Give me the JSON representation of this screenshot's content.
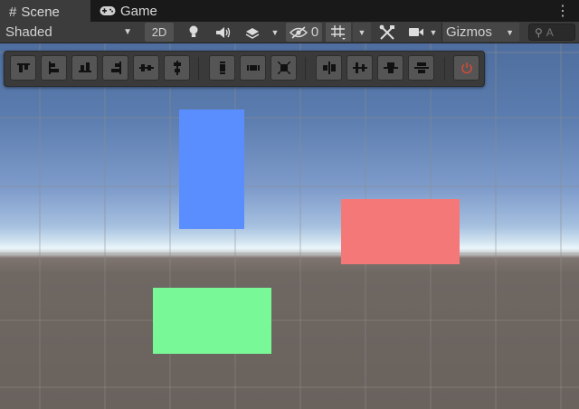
{
  "tabs": [
    {
      "label": "Scene",
      "icon": "grid-hash-icon",
      "active": true
    },
    {
      "label": "Game",
      "icon": "gamepad-icon",
      "active": false
    }
  ],
  "toolbar": {
    "draw_mode": "Shaded",
    "mode_2d": "2D",
    "hidden_count": "0",
    "gizmos": "Gizmos",
    "search_placeholder": "A"
  },
  "align_tools": [
    "align-top-icon",
    "align-left-icon",
    "align-bottom-icon",
    "align-right-icon",
    "align-center-horizontal-icon",
    "align-center-vertical-icon",
    "distribute-vertical-icon",
    "distribute-horizontal-icon",
    "distribute-center-icon",
    "align-middle-horizontal-icon",
    "align-middle-vertical-icon",
    "align-top-edge-icon",
    "align-bottom-edge-icon",
    "power-icon"
  ],
  "colors": {
    "blue_rect": "#5a8efe",
    "red_rect": "#f57878",
    "green_rect": "#78f896",
    "power_icon": "#d04a3a"
  }
}
